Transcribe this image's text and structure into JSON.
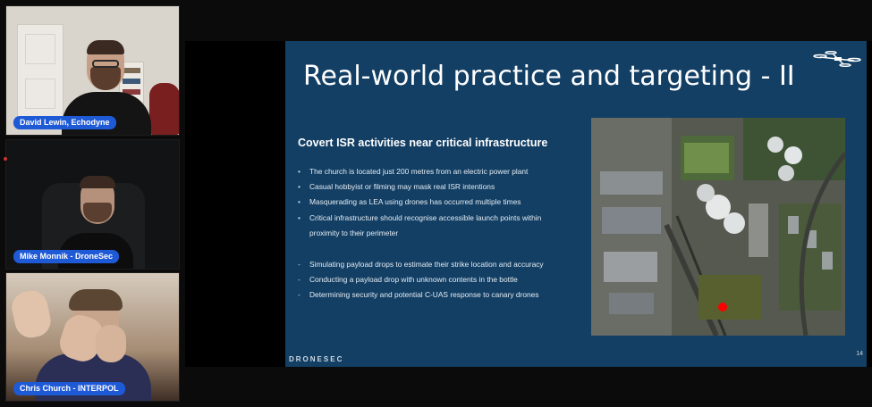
{
  "participants": [
    {
      "name": "David Lewin, Echodyne"
    },
    {
      "name": "Mike Monnik - DroneSec"
    },
    {
      "name": "Chris Church - INTERPOL"
    }
  ],
  "slide": {
    "title": "Real-world practice and targeting - II",
    "section_heading": "Covert ISR activities near critical infrastructure",
    "bullets": [
      "The church is located just 200 metres from an electric power plant",
      "Casual hobbyist or filming may mask real ISR intentions",
      "Masquerading as LEA using drones has occurred multiple times",
      "Critical infrastructure should recognise accessible launch points within",
      "proximity to their perimeter"
    ],
    "dash_items": [
      "Simulating payload drops to estimate their strike location and accuracy",
      "Conducting a payload drop with unknown contents in the bottle",
      "Determining security and potential C-UAS response to canary drones"
    ],
    "footer_brand": "DRONESEC",
    "page_number": "14",
    "map_marker_color": "#ff0000",
    "slide_background": "#133f64"
  },
  "colors": {
    "name_badge": "#1f5ad6",
    "background": "#0b0b0b"
  }
}
